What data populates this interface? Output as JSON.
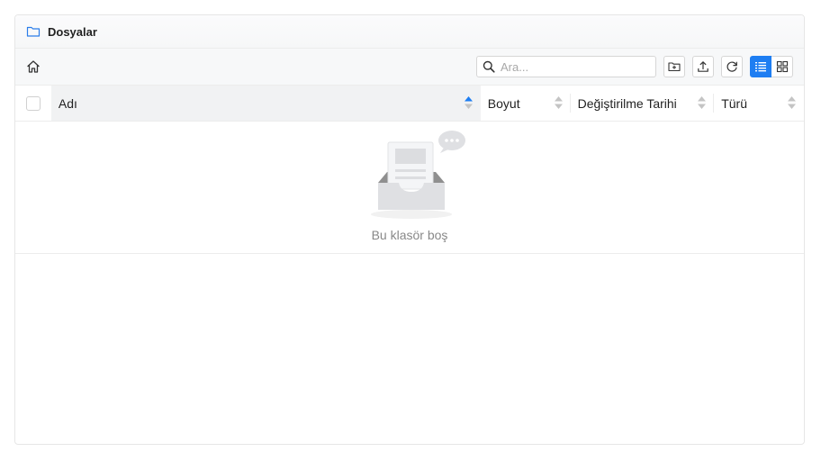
{
  "window": {
    "title": "Dosyalar",
    "title_icon": "folder-icon"
  },
  "toolbar": {
    "home_icon": "home-icon",
    "search_placeholder": "Ara...",
    "search_value": "",
    "buttons": [
      "new-folder-icon",
      "upload-icon",
      "refresh-icon"
    ],
    "view_modes": [
      "list-view-icon",
      "grid-view-icon"
    ],
    "active_view": "list"
  },
  "table": {
    "columns": [
      {
        "label": "Adı",
        "sorted": "ascending"
      },
      {
        "label": "Boyut",
        "sorted": "none"
      },
      {
        "label": "Değiştirilme Tarihi",
        "sorted": "none"
      },
      {
        "label": "Türü",
        "sorted": "none"
      }
    ],
    "rows": [],
    "empty_text": "Bu klasör boş"
  },
  "colors": {
    "accent": "#1e7ef2",
    "folder_icon": "#2b7de9",
    "header_active": "#f1f2f3",
    "sort_inactive": "#c4c4c4"
  }
}
